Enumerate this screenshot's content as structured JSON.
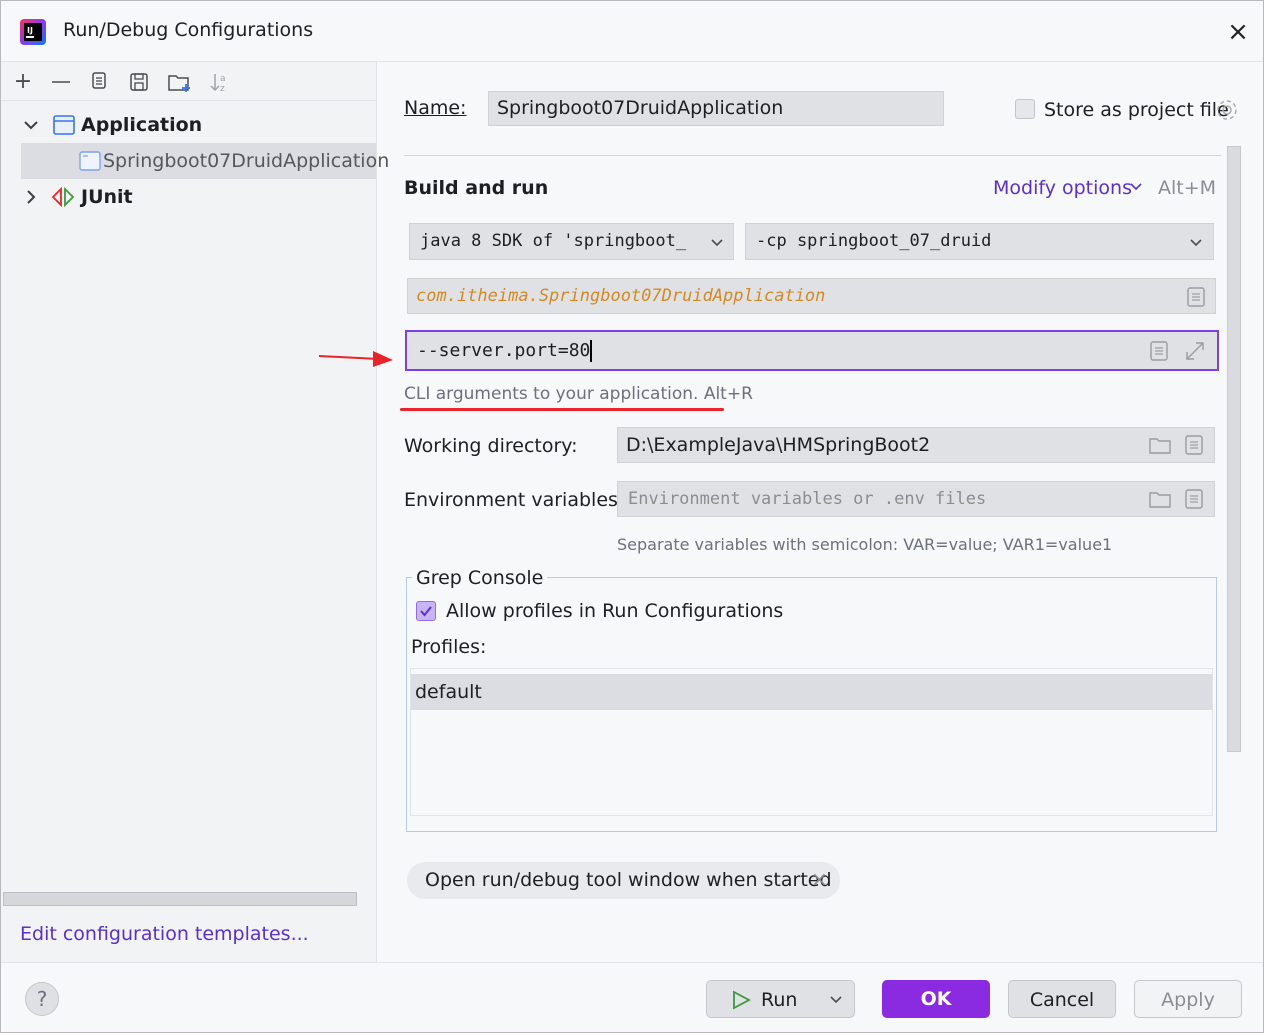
{
  "window": {
    "title": "Run/Debug Configurations",
    "close_icon": "×"
  },
  "toolbar": {
    "add_icon": "+",
    "remove_icon": "—",
    "copy_icon": "copy-icon",
    "save_icon": "save-icon",
    "folder_icon": "new-folder-icon",
    "sort_icon": "sort-icon"
  },
  "tree": {
    "application_label": "Application",
    "config_label": "Springboot07DruidApplication",
    "junit_label": "JUnit",
    "expanded_glyph": "⌄",
    "collapsed_glyph": "›"
  },
  "left_footer": {
    "edit_templates": "Edit configuration templates..."
  },
  "form": {
    "name_label": "Name:",
    "name_value": "Springboot07DruidApplication",
    "store_label": "Store as project file",
    "section_title": "Build and run",
    "modify_options": "Modify options",
    "modify_shortcut": "Alt+M",
    "jre_value": "java 8 SDK of 'springboot_",
    "classpath_value": "-cp springboot_07_druid",
    "main_class": "com.itheima.Springboot07DruidApplication",
    "program_args": "--server.port=80",
    "args_hint": "CLI arguments to your application. Alt+R",
    "workdir_label": "Working directory:",
    "workdir_value": "D:\\ExampleJava\\HMSpringBoot2",
    "env_label": "Environment variables:",
    "env_placeholder": "Environment variables or .env files",
    "env_hint": "Separate variables with semicolon: VAR=value; VAR1=value1"
  },
  "grep_console": {
    "title": "Grep Console",
    "allow_profiles": "Allow profiles in Run Configurations",
    "allow_checked": true,
    "profiles_label": "Profiles:",
    "profiles": [
      "default"
    ]
  },
  "chip": {
    "label": "Open run/debug tool window when started",
    "close_glyph": "×"
  },
  "footer": {
    "help": "?",
    "run": "Run",
    "ok": "OK",
    "cancel": "Cancel",
    "apply": "Apply"
  },
  "colors": {
    "accent": "#7b3fe4",
    "ok_bg": "#8a2be2",
    "annotation_red": "#e8242a",
    "main_class_color": "#d48a1f",
    "link": "#5a2fd1"
  }
}
